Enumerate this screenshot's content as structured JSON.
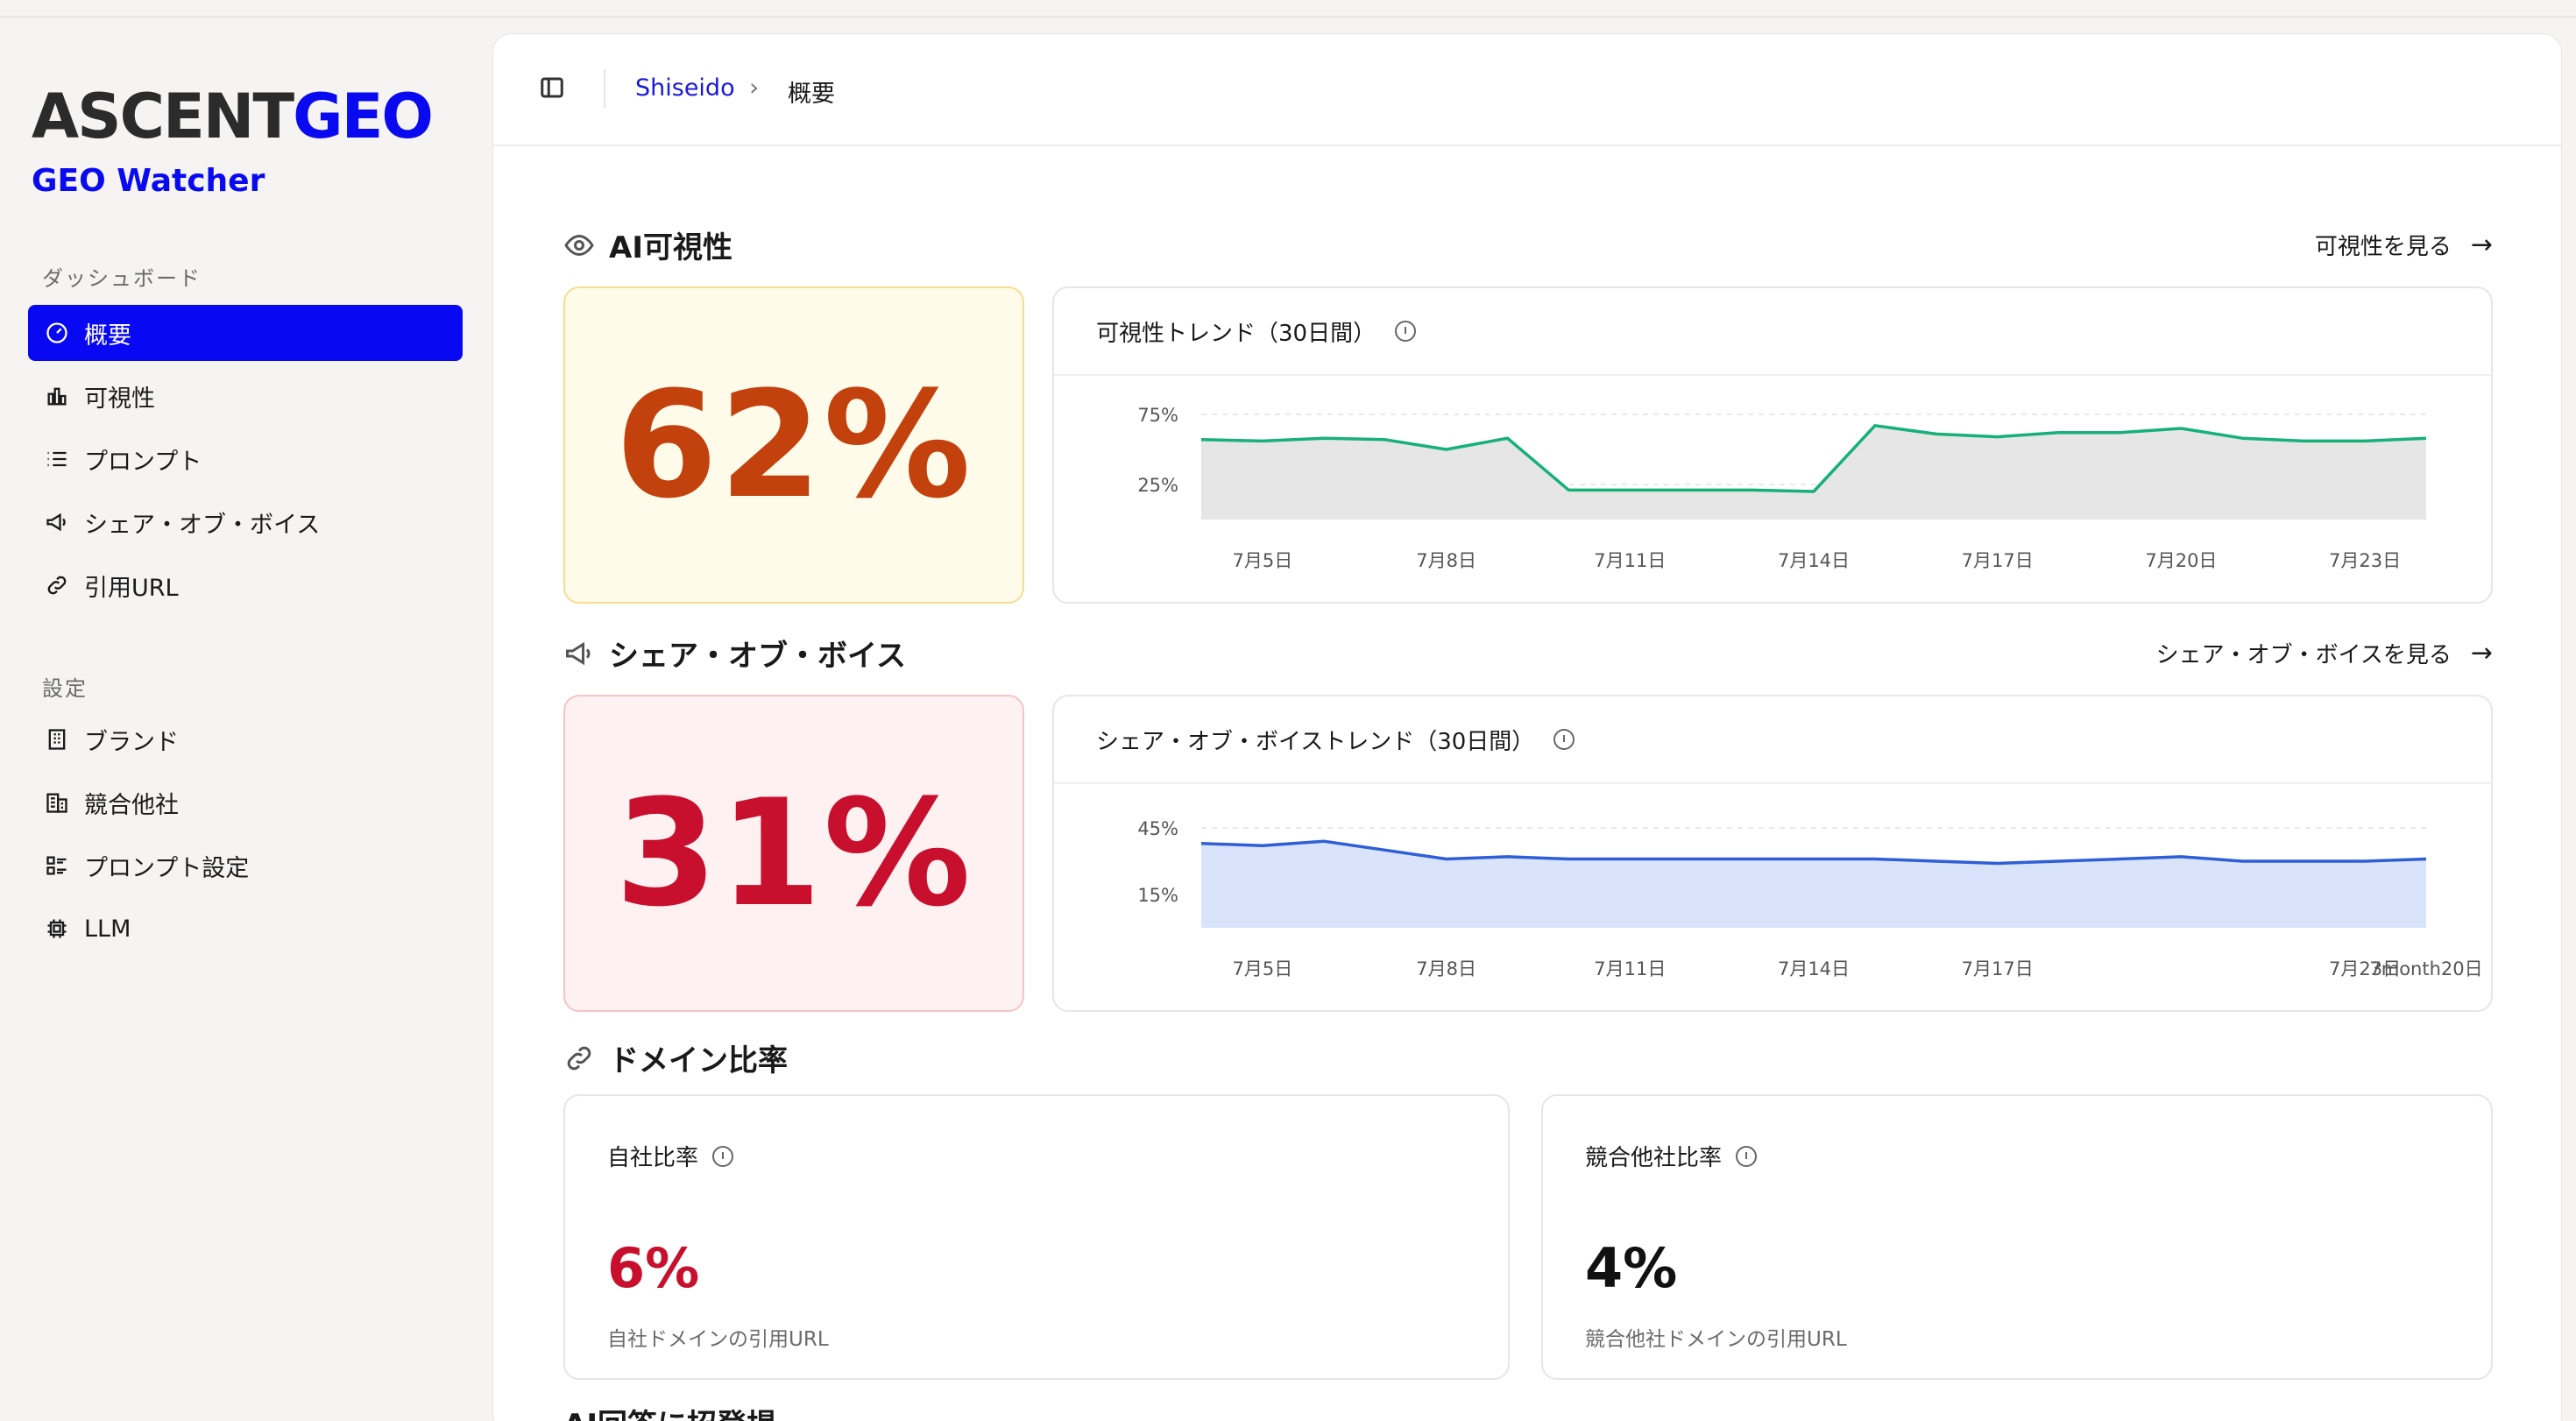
{
  "brand": {
    "logo_ascent": "ASCENT",
    "logo_geo": "GEO",
    "subtitle": "GEO Watcher"
  },
  "sidebar": {
    "section_dashboard": "ダッシュボード",
    "dashboard_items": [
      {
        "label": "概要",
        "icon": "gauge-icon",
        "active": true
      },
      {
        "label": "可視性",
        "icon": "bar-chart-icon"
      },
      {
        "label": "プロンプト",
        "icon": "list-icon"
      },
      {
        "label": "シェア・オブ・ボイス",
        "icon": "megaphone-icon"
      },
      {
        "label": "引用URL",
        "icon": "link-icon"
      }
    ],
    "section_settings": "設定",
    "settings_items": [
      {
        "label": "ブランド",
        "icon": "building-icon"
      },
      {
        "label": "競合他社",
        "icon": "buildings-icon"
      },
      {
        "label": "プロンプト設定",
        "icon": "list-settings-icon"
      },
      {
        "label": "LLM",
        "icon": "chip-icon"
      }
    ]
  },
  "header": {
    "breadcrumb_parent": "Shiseido",
    "breadcrumb_current": "概要"
  },
  "visibility": {
    "title": "AI可視性",
    "link": "可視性を見る",
    "value": "62%",
    "chart_title": "可視性トレンド（30日間）"
  },
  "sov": {
    "title": "シェア・オブ・ボイス",
    "link": "シェア・オブ・ボイスを見る",
    "value": "31%",
    "chart_title": "シェア・オブ・ボイストレンド（30日間）"
  },
  "domain": {
    "title": "ドメイン比率",
    "own_label": "自社比率",
    "own_value": "6%",
    "own_sub": "自社ドメインの引用URL",
    "comp_label": "競合他社比率",
    "comp_value": "4%",
    "comp_sub": "競合他社ドメインの引用URL"
  },
  "next_section_title": "AI回答に招登場",
  "colors": {
    "accent": "#0808f2",
    "visibility_line": "#16b07a",
    "sov_line": "#2f5fd6"
  },
  "chart_data": [
    {
      "type": "area",
      "title": "可視性トレンド（30日間）",
      "x": [
        "7月4日",
        "7月5日",
        "7月6日",
        "7月7日",
        "7月8日",
        "7月9日",
        "7月10日",
        "7月11日",
        "7月12日",
        "7月13日",
        "7月14日",
        "7月15日",
        "7月16日",
        "7月17日",
        "7月18日",
        "7月19日",
        "7月20日",
        "7月21日",
        "7月22日",
        "7月23日",
        "7月24日"
      ],
      "tick_labels": [
        "7月5日",
        "7月8日",
        "7月11日",
        "7月14日",
        "7月17日",
        "7月20日",
        "7月23日"
      ],
      "y_ticks": [
        {
          "value": 75,
          "label": "75%"
        },
        {
          "value": 25,
          "label": "25%"
        }
      ],
      "ylim": [
        0,
        95
      ],
      "series": [
        {
          "values": [
            57,
            56,
            58,
            57,
            50,
            58,
            21,
            21,
            21,
            21,
            20,
            67,
            61,
            59,
            62,
            62,
            65,
            58,
            56,
            56,
            58
          ]
        }
      ]
    },
    {
      "type": "area",
      "title": "シェア・オブ・ボイストレンド（30日間）",
      "x": [
        "7月4日",
        "7月5日",
        "7月6日",
        "7月7日",
        "7月8日",
        "7月9日",
        "7月10日",
        "7月11日",
        "7月12日",
        "7月13日",
        "7月14日",
        "7月15日",
        "7月16日",
        "7月17日",
        "7月18日",
        "7月19日",
        "7月20日",
        "7月21日",
        "7月22日",
        "7月23日",
        "7月24日"
      ],
      "tick_labels": [
        "7月5日",
        "7月8日",
        "7月11日",
        "7月14日",
        "7月17日",
        "7month20日",
        "7月23日"
      ],
      "y_ticks": [
        {
          "value": 45,
          "label": "45%"
        },
        {
          "value": 15,
          "label": "15%"
        }
      ],
      "ylim": [
        0,
        60
      ],
      "series": [
        {
          "values": [
            38,
            37,
            39,
            35,
            31,
            32,
            31,
            31,
            31,
            31,
            31,
            31,
            30,
            29,
            30,
            31,
            32,
            30,
            30,
            30,
            31
          ]
        }
      ]
    }
  ]
}
